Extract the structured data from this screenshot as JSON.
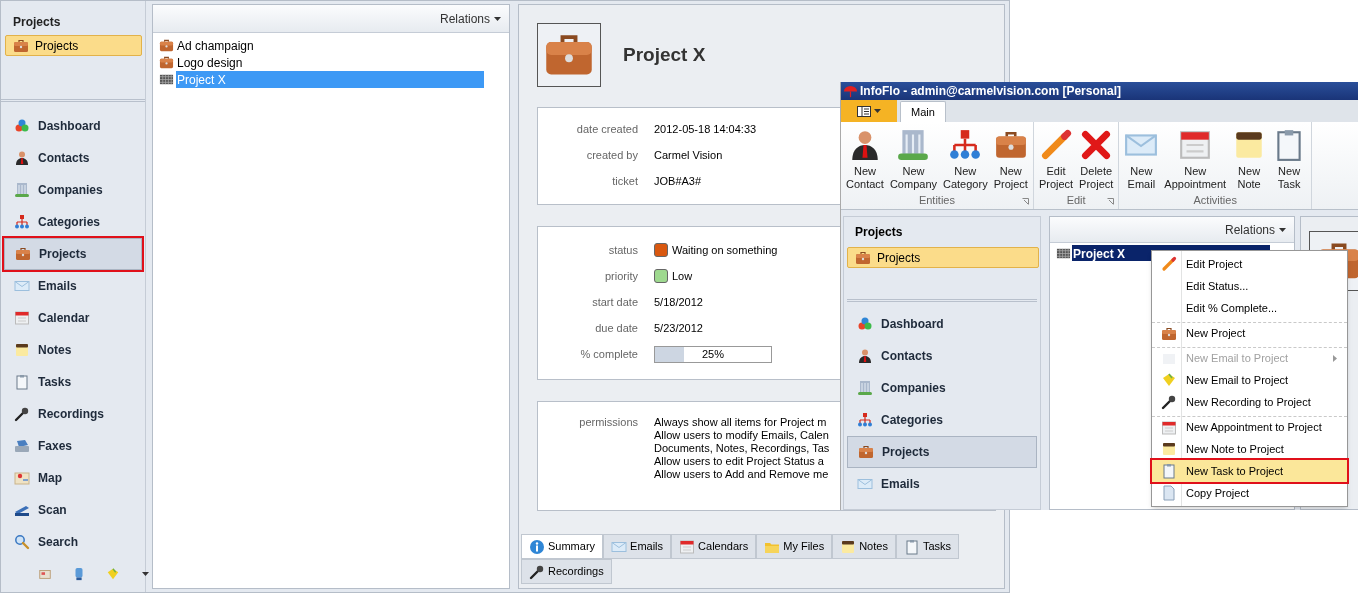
{
  "sidebar": {
    "header": "Projects",
    "current": {
      "label": "Projects",
      "selected": true
    },
    "items": [
      {
        "label": "Dashboard",
        "selected": false,
        "outlined": false
      },
      {
        "label": "Contacts",
        "selected": false,
        "outlined": false
      },
      {
        "label": "Companies",
        "selected": false,
        "outlined": false
      },
      {
        "label": "Categories",
        "selected": false,
        "outlined": false
      },
      {
        "label": "Projects",
        "selected": true,
        "outlined": true
      },
      {
        "label": "Emails",
        "selected": false,
        "outlined": false
      },
      {
        "label": "Calendar",
        "selected": false,
        "outlined": false
      },
      {
        "label": "Notes",
        "selected": false,
        "outlined": false
      },
      {
        "label": "Tasks",
        "selected": false,
        "outlined": false
      },
      {
        "label": "Recordings",
        "selected": false,
        "outlined": false
      },
      {
        "label": "Faxes",
        "selected": false,
        "outlined": false
      },
      {
        "label": "Map",
        "selected": false,
        "outlined": false
      },
      {
        "label": "Scan",
        "selected": false,
        "outlined": false
      },
      {
        "label": "Search",
        "selected": false,
        "outlined": false
      }
    ]
  },
  "list": {
    "relations": "Relations",
    "items": [
      {
        "label": "Ad champaign",
        "selected": false
      },
      {
        "label": "Logo design",
        "selected": false
      },
      {
        "label": "Project X",
        "selected": true
      }
    ]
  },
  "detail": {
    "title": "Project X",
    "info": [
      {
        "label": "date created",
        "value": "2012-05-18 14:04:33"
      },
      {
        "label": "created by",
        "value": "Carmel Vision"
      },
      {
        "label": "ticket",
        "value": "JOB#A3#"
      }
    ],
    "status": [
      {
        "kind": "swatch",
        "label": "status",
        "value": "Waiting on something",
        "color": "#d9580f"
      },
      {
        "kind": "swatch",
        "label": "priority",
        "value": "Low",
        "color": "#9ed98f"
      },
      {
        "kind": "text",
        "label": "start date",
        "value": "5/18/2012"
      },
      {
        "kind": "text",
        "label": "due date",
        "value": "5/23/2012"
      },
      {
        "kind": "progress",
        "label": "% complete",
        "level": 0.25,
        "reading": "25%"
      }
    ],
    "permissions": {
      "label": "permissions",
      "lines": [
        "Always show all items for Project m",
        "Allow users to modify Emails, Calen",
        "Documents, Notes, Recordings, Tas",
        "Allow users to edit Project Status a",
        "Allow users to Add and Remove me"
      ]
    }
  },
  "tabs": [
    {
      "label": "Summary",
      "selected": true
    },
    {
      "label": "Emails",
      "selected": false
    },
    {
      "label": "Calendars",
      "selected": false
    },
    {
      "label": "My Files",
      "selected": false
    },
    {
      "label": "Notes",
      "selected": false
    },
    {
      "label": "Tasks",
      "selected": false
    },
    {
      "label": "Recordings",
      "selected": false
    }
  ],
  "inset": {
    "title": "InfoFlo - admin@carmelvision.com [Personal]",
    "ribbon_tabs": [
      {
        "label": "Main",
        "selected": true
      }
    ],
    "groups": [
      {
        "label": "Entities",
        "launcher": true,
        "buttons": [
          "New Contact",
          "New Company",
          "New Category",
          "New Project"
        ]
      },
      {
        "label": "Edit",
        "launcher": true,
        "buttons": [
          "Edit Project",
          "Delete Project"
        ]
      },
      {
        "label": "Activities",
        "launcher": false,
        "buttons": [
          "New Email",
          "New Appointment",
          "New Note",
          "New Task"
        ]
      }
    ],
    "sidebar": {
      "header": "Projects",
      "current": {
        "label": "Projects",
        "selected": true
      },
      "items": [
        {
          "label": "Dashboard",
          "selected": false
        },
        {
          "label": "Contacts",
          "selected": false
        },
        {
          "label": "Companies",
          "selected": false
        },
        {
          "label": "Categories",
          "selected": false
        },
        {
          "label": "Projects",
          "selected": true
        },
        {
          "label": "Emails",
          "selected": false
        }
      ]
    },
    "relations": "Relations",
    "tree": {
      "label": "Project X",
      "selected": true
    },
    "menu": [
      {
        "label": "Edit Project",
        "disabled": false,
        "selected": false,
        "separator_before": false,
        "submenu": false,
        "outlined": false
      },
      {
        "label": "Edit Status...",
        "disabled": false,
        "selected": false,
        "separator_before": false,
        "submenu": false,
        "outlined": false
      },
      {
        "label": "Edit % Complete...",
        "disabled": false,
        "selected": false,
        "separator_before": false,
        "submenu": false,
        "outlined": false
      },
      {
        "label": "New Project",
        "disabled": false,
        "selected": false,
        "separator_before": true,
        "submenu": false,
        "outlined": false
      },
      {
        "label": "New Email to Project",
        "disabled": true,
        "selected": false,
        "separator_before": true,
        "submenu": true,
        "outlined": false
      },
      {
        "label": "New Email to Project",
        "disabled": false,
        "selected": false,
        "separator_before": false,
        "submenu": false,
        "outlined": false
      },
      {
        "label": "New Recording to Project",
        "disabled": false,
        "selected": false,
        "separator_before": false,
        "submenu": false,
        "outlined": false
      },
      {
        "label": "New Appointment to Project",
        "disabled": false,
        "selected": false,
        "separator_before": true,
        "submenu": false,
        "outlined": false
      },
      {
        "label": "New Note to Project",
        "disabled": false,
        "selected": false,
        "separator_before": false,
        "submenu": false,
        "outlined": false
      },
      {
        "label": "New Task to Project",
        "disabled": false,
        "selected": true,
        "separator_before": false,
        "submenu": false,
        "outlined": true
      },
      {
        "label": "Copy Project",
        "disabled": false,
        "selected": false,
        "separator_before": false,
        "submenu": false,
        "outlined": false
      }
    ]
  }
}
